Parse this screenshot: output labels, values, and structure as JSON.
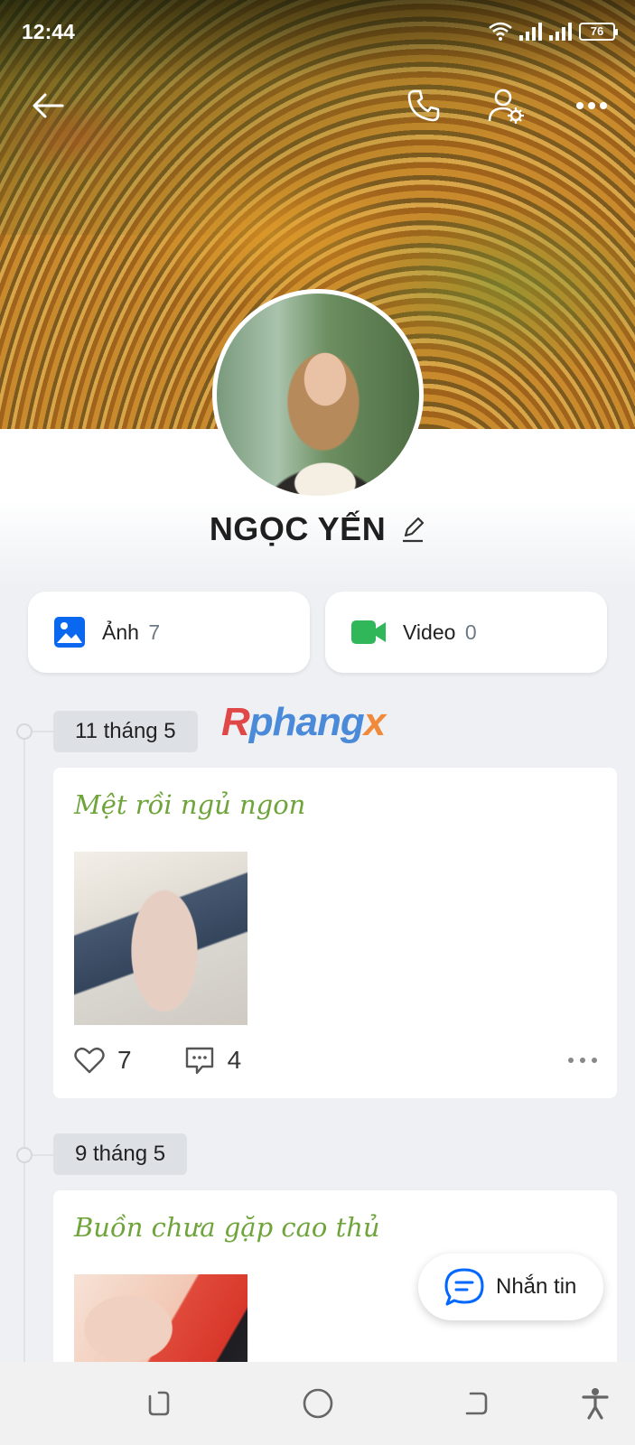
{
  "status_bar": {
    "time": "12:44",
    "battery": "76"
  },
  "profile": {
    "name": "NGỌC YẾN"
  },
  "media": [
    {
      "label": "Ảnh",
      "count": "7"
    },
    {
      "label": "Video",
      "count": "0"
    }
  ],
  "watermark": {
    "part1": "R",
    "part2": "phang",
    "part3": "x"
  },
  "timeline": [
    {
      "date": "11 tháng 5",
      "text": "Mệt rồi ngủ ngon",
      "likes": "7",
      "comments": "4"
    },
    {
      "date": "9 tháng 5",
      "text": "Buồn chưa gặp cao thủ"
    }
  ],
  "fab": {
    "label": "Nhắn tin"
  },
  "colors": {
    "accent": "#0068ff",
    "post_text": "#6ea43a",
    "video_icon": "#2fb75a"
  },
  "icons": [
    "back-arrow-icon",
    "phone-icon",
    "user-settings-icon",
    "more-icon",
    "image-icon",
    "video-camera-icon",
    "edit-pencil-icon",
    "heart-icon",
    "comment-icon",
    "chat-bubble-icon"
  ]
}
